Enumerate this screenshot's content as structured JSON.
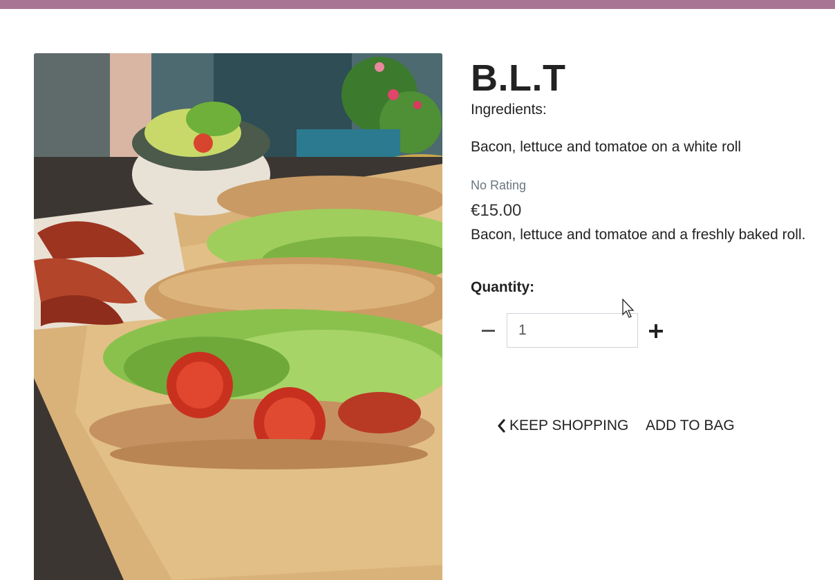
{
  "header": {
    "color": "#a87595"
  },
  "product": {
    "image_alt": "BLT sandwich on a wooden board",
    "title": "B.L.T",
    "ingredients_label": "Ingredients:",
    "ingredients": "Bacon, lettuce and tomatoe on a white roll",
    "rating": "No Rating",
    "price": "€15.00",
    "description": "Bacon, lettuce and tomatoe and a freshly baked roll."
  },
  "quantity": {
    "label": "Quantity:",
    "value": "1",
    "decrement_icon": "minus-icon",
    "increment_icon": "plus-icon"
  },
  "actions": {
    "keep_shopping": "Keep Shopping",
    "keep_shopping_icon": "chevron-left-icon",
    "add_to_bag": "Add to Bag"
  }
}
